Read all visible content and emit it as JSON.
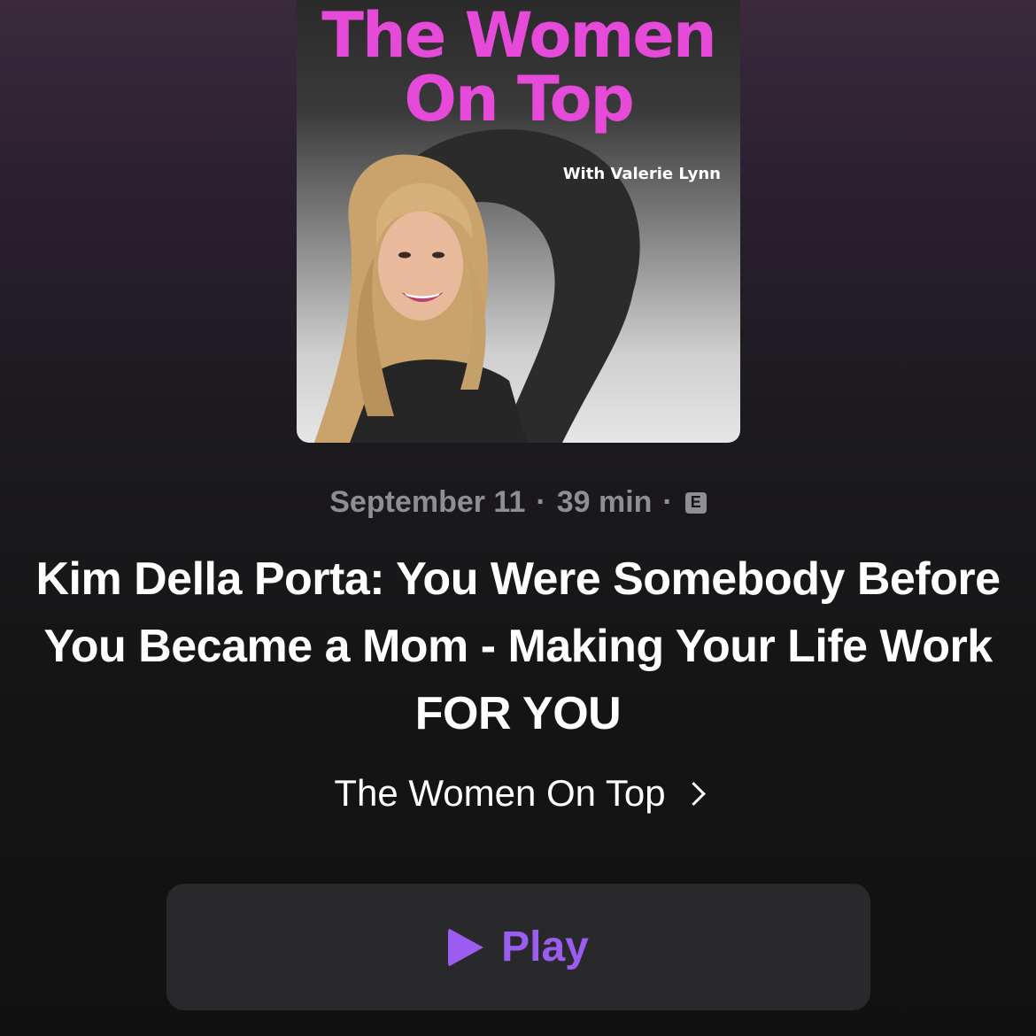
{
  "artwork": {
    "title": "The Women On Top",
    "title_line1": "The Women",
    "title_line2": "On Top",
    "subtitle": "With Valerie Lynn",
    "accent_color": "#e64ad9"
  },
  "episode": {
    "date": "September 11",
    "separator": "·",
    "duration": "39 min",
    "explicit_badge": "E",
    "title": "Kim Della Porta: You Were Somebody Before You Became a Mom - Making Your Life Work FOR YOU"
  },
  "show": {
    "name": "The Women On Top",
    "chevron_icon": "chevron-right-icon"
  },
  "play_button": {
    "label": "Play",
    "icon": "play-icon",
    "color": "#9b5cf0"
  }
}
